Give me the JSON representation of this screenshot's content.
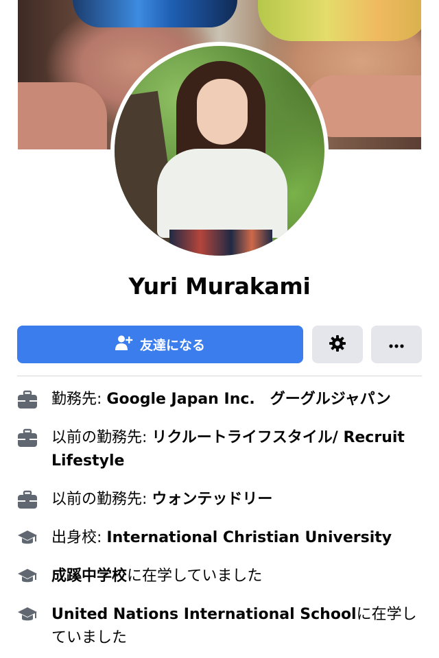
{
  "profile": {
    "name": "Yuri Murakami"
  },
  "actions": {
    "add_friend_label": "友達になる"
  },
  "about": {
    "work": {
      "label": "勤務先: ",
      "value": "Google Japan Inc.　グーグルジャパン"
    },
    "past_work_1": {
      "label": "以前の勤務先: ",
      "value": "リクルートライフスタイル/ Recruit Lifestyle"
    },
    "past_work_2": {
      "label": "以前の勤務先: ",
      "value": "ウォンテッドリー"
    },
    "university": {
      "label": "出身校: ",
      "value": "International Christian University"
    },
    "middle_school": {
      "value": "成蹊中学校",
      "suffix": "に在学していました"
    },
    "school": {
      "value": "United Nations International School",
      "suffix": "に在学していました"
    }
  },
  "colors": {
    "primary": "#3b7ded",
    "secondary_button": "#e4e6eb",
    "icon_gray": "#606770"
  }
}
